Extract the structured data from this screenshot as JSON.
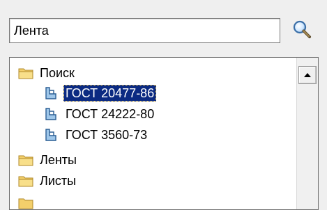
{
  "search": {
    "value": "Лента",
    "icon": "magnifier-icon"
  },
  "tree": {
    "items": [
      {
        "label": "Поиск",
        "icon": "folder-icon",
        "level": 0,
        "selected": false
      },
      {
        "label": "ГОСТ 20477-86",
        "icon": "profile-part-icon",
        "level": 1,
        "selected": true
      },
      {
        "label": "ГОСТ 24222-80",
        "icon": "profile-part-icon",
        "level": 1,
        "selected": false
      },
      {
        "label": "ГОСТ 3560-73",
        "icon": "profile-part-icon",
        "level": 1,
        "selected": false
      },
      {
        "label": "Ленты",
        "icon": "folder-icon",
        "level": 0,
        "selected": false
      },
      {
        "label": "Листы",
        "icon": "folder-icon",
        "level": 0,
        "selected": false
      }
    ]
  },
  "scrollbar": {
    "up_icon": "arrow-up-icon"
  },
  "colors": {
    "selection_bg": "#0b2a82",
    "selection_text": "#ffffff",
    "folder": "#f3cf6b"
  }
}
